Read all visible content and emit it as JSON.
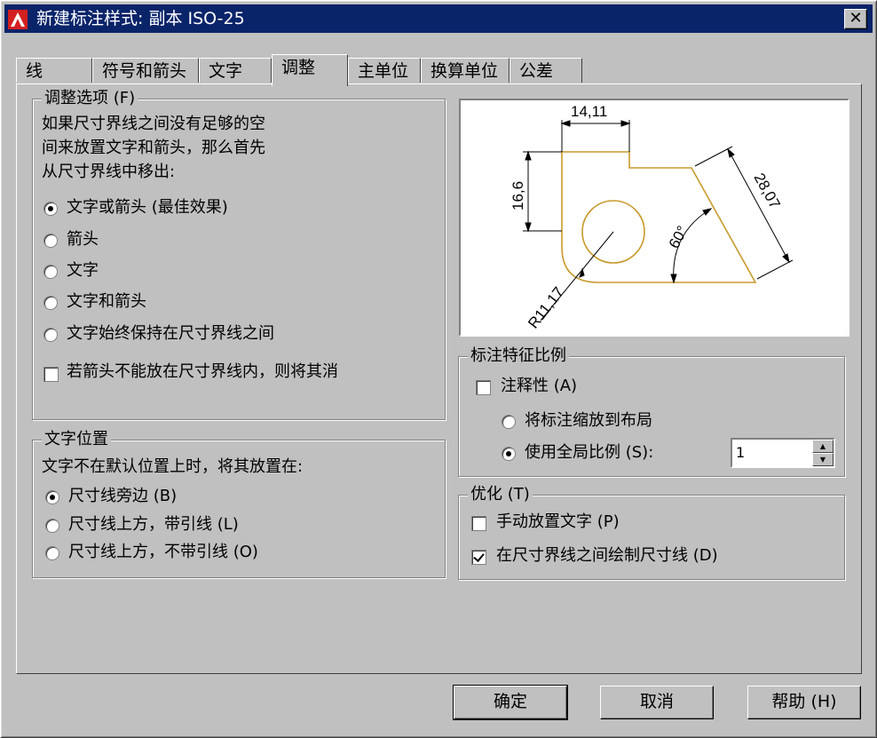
{
  "window": {
    "title": "新建标注样式: 副本 ISO-25",
    "close_glyph": "✕"
  },
  "tabs": [
    "线",
    "符号和箭头",
    "文字",
    "调整",
    "主单位",
    "换算单位",
    "公差"
  ],
  "adjust": {
    "legend": "调整选项 (F)",
    "description": [
      "如果尺寸界线之间没有足够的空",
      "间来放置文字和箭头，那么首先",
      "从尺寸界线中移出:"
    ],
    "options": [
      "文字或箭头 (最佳效果)",
      "箭头",
      "文字",
      "文字和箭头",
      "文字始终保持在尺寸界线之间"
    ],
    "selected": 0,
    "suppress_label": "若箭头不能放在尺寸界线内，则将其消",
    "suppress_checked": false
  },
  "text_position": {
    "legend": "文字位置",
    "description": "文字不在默认位置上时，将其放置在:",
    "options": [
      "尺寸线旁边 (B)",
      "尺寸线上方，带引线 (L)",
      "尺寸线上方，不带引线 (O)"
    ],
    "selected": 0
  },
  "preview": {
    "labels": {
      "dim_top": "14,11",
      "dim_left": "16,6",
      "dim_right": "28,07",
      "angle": "60°",
      "radius": "R11,17"
    },
    "line_color": "#c89a2c"
  },
  "scale": {
    "legend": "标注特征比例",
    "annotative_label": "注释性 (A)",
    "annotative_checked": false,
    "options": [
      "将标注缩放到布局",
      "使用全局比例 (S):"
    ],
    "selected": 1,
    "value": "1"
  },
  "fine_tune": {
    "legend": "优化 (T)",
    "manual_label": "手动放置文字 (P)",
    "manual_checked": false,
    "draw_between_label": "在尺寸界线之间绘制尺寸线 (D)",
    "draw_between_checked": true
  },
  "buttons": {
    "ok": "确定",
    "cancel": "取消",
    "help": "帮助 (H)"
  }
}
